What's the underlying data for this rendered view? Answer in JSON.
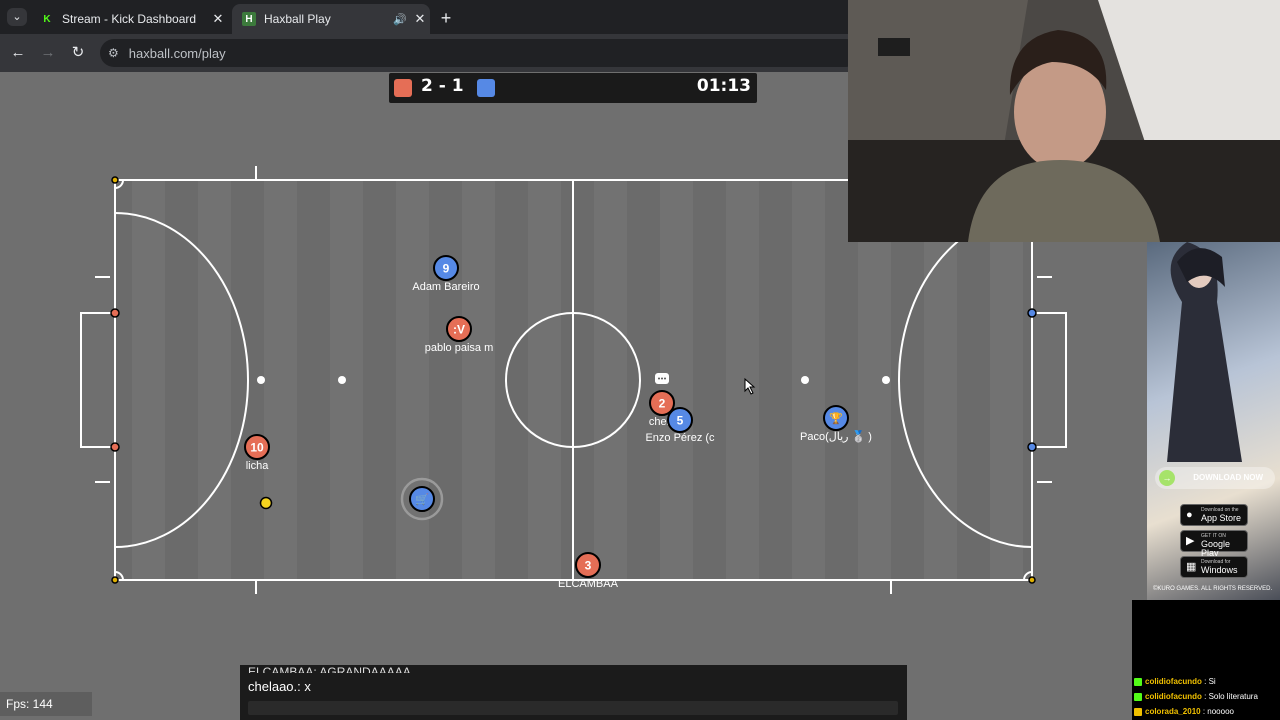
{
  "browser": {
    "tab_list_icon": "chevron-down-icon",
    "tabs": [
      {
        "title": "Stream - Kick Dashboard",
        "icon": "kick-icon"
      },
      {
        "title": "Haxball Play",
        "icon": "haxball-icon",
        "audio": "speaker-icon"
      }
    ],
    "url": "haxball.com/play"
  },
  "game": {
    "score": "2 - 1",
    "timer": "01:13",
    "red_color": "#e56e56",
    "blue_color": "#5689e5",
    "fps": "Fps: 144",
    "players": [
      {
        "team": "blue",
        "avatar": "9",
        "name": "Adam Bareiro"
      },
      {
        "team": "red",
        "avatar": ":V",
        "name": "pablo paisa m"
      },
      {
        "team": "red",
        "avatar": "10",
        "name": "licha"
      },
      {
        "team": "blue",
        "avatar": "cart",
        "name": ""
      },
      {
        "team": "red",
        "avatar": "2",
        "name": "chela"
      },
      {
        "team": "blue",
        "avatar": "5",
        "name": "Enzo Pérez (c"
      },
      {
        "team": "blue",
        "avatar": "medal",
        "name": "Paco(ريال 🥈 )"
      },
      {
        "team": "red",
        "avatar": "3",
        "name": "ELCAMBAA"
      }
    ],
    "chat": {
      "partial_line": "ELCAMBAA: AGRANDAAAAA",
      "last_line": "chelaao.: x"
    }
  },
  "ad": {
    "download": "DOWNLOAD NOW",
    "stores": [
      {
        "small": "Download on the",
        "label": "App Store"
      },
      {
        "small": "GET IT ON",
        "label": "Google Play"
      },
      {
        "small": "Download for",
        "label": "Windows"
      }
    ],
    "copyright": "©KURO GAMES. ALL RIGHTS RESERVED."
  },
  "stream_chat": [
    {
      "user": "colidiofacundo",
      "message": "Si"
    },
    {
      "user": "colidiofacundo",
      "message": "Solo literatura"
    },
    {
      "user": "colorada_2010",
      "message": "nooooo"
    }
  ]
}
